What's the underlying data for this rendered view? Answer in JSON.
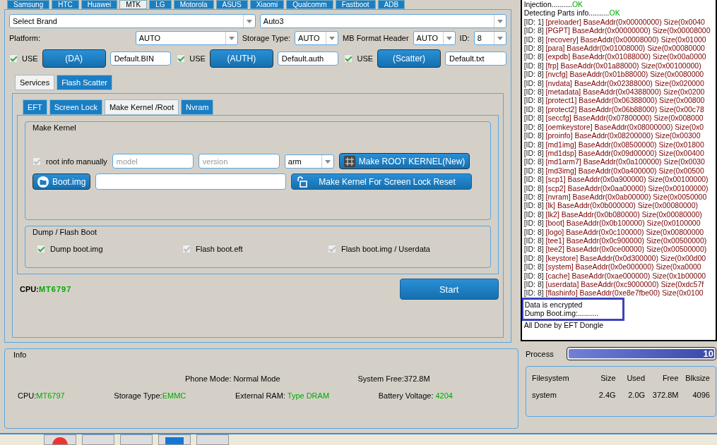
{
  "brand_tabs": [
    {
      "label": "Samsung",
      "selected": false
    },
    {
      "label": "HTC",
      "selected": false
    },
    {
      "label": "Huawei",
      "selected": false
    },
    {
      "label": "MTK",
      "selected": true
    },
    {
      "label": "LG",
      "selected": false
    },
    {
      "label": "Motorola",
      "selected": false
    },
    {
      "label": "ASUS",
      "selected": false
    },
    {
      "label": "Xiaomi",
      "selected": false
    },
    {
      "label": "Qualcomm",
      "selected": false
    },
    {
      "label": "Fastboot",
      "selected": false
    },
    {
      "label": "ADB",
      "selected": false
    }
  ],
  "brand_select": {
    "value": "Select Brand"
  },
  "mode_select": {
    "value": "Auto3"
  },
  "platform": {
    "label": "Platform:",
    "value": "AUTO"
  },
  "storage_type": {
    "label": "Storage Type:",
    "value": "AUTO"
  },
  "mb_format_header": {
    "label": "MB Format Header",
    "value": "AUTO"
  },
  "id": {
    "label": "ID:",
    "value": "8"
  },
  "file_rows": [
    {
      "use_label": "USE",
      "checked": true,
      "button": "(DA)",
      "file": "Default.BIN"
    },
    {
      "use_label": "USE",
      "checked": true,
      "button": "(AUTH)",
      "file": "Default.auth"
    },
    {
      "use_label": "USE",
      "checked": true,
      "button": "(Scatter)",
      "file": "Default.txt"
    }
  ],
  "section_tabs": [
    {
      "label": "Services",
      "selected": true
    },
    {
      "label": "Flash Scatter",
      "selected": false
    }
  ],
  "service_tabs": [
    {
      "label": "EFT",
      "selected": false
    },
    {
      "label": "Screen Lock",
      "selected": false
    },
    {
      "label": "Make Kernel  /Root",
      "selected": true
    },
    {
      "label": "Nvram",
      "selected": false
    }
  ],
  "make_kernel": {
    "title": "Make Kernel",
    "root_info": {
      "label": "root info manually",
      "checked": true,
      "disabled": true
    },
    "model_placeholder": "model",
    "version_placeholder": "version",
    "arch": "arm",
    "make_root_button": "Make  ROOT KERNEL(New)",
    "boot_button": "Boot.img",
    "screen_lock_button": "Make Kernel For Screen Lock Reset"
  },
  "dump_flash": {
    "title": "Dump / Flash Boot",
    "options": [
      {
        "label": "Dump boot.img",
        "checked": true,
        "disabled": false
      },
      {
        "label": "Flash boot.eft",
        "checked": true,
        "disabled": true
      },
      {
        "label": "Flash boot.img / Userdata",
        "checked": true,
        "disabled": true
      }
    ]
  },
  "cpu": {
    "label": "CPU:",
    "value": "MT6797"
  },
  "start_button": "Start",
  "info": {
    "title": "Info",
    "phone_mode": "Phone Mode: Normal Mode",
    "system_free": "System Free:372.8M",
    "cpu_label": "CPU:",
    "cpu_value": "MT6797",
    "storage_label": "Storage Type:",
    "storage_value": "EMMC",
    "ram_label": "External RAM: ",
    "ram_value": "Type DRAM",
    "battery_label": "Battery Voltage: ",
    "battery_value": "4204"
  },
  "log": {
    "lines": [
      {
        "kind": "status",
        "text": "Injection..........",
        "status": "OK"
      },
      {
        "kind": "status",
        "text": "Detecting Parts info..........",
        "status": "OK"
      },
      {
        "kind": "part",
        "id": "[ID: 1]",
        "text": "[preloader] BaseAddr(0x00000000) Size(0x0040"
      },
      {
        "kind": "part",
        "id": "[ID: 8]",
        "text": "[PGPT] BaseAddr(0x00000000) Size(0x00008000"
      },
      {
        "kind": "part",
        "id": "[ID: 8]",
        "text": "[recovery] BaseAddr(0x00008000) Size(0x01000"
      },
      {
        "kind": "part",
        "id": "[ID: 8]",
        "text": "[para] BaseAddr(0x01008000) Size(0x00080000"
      },
      {
        "kind": "part",
        "id": "[ID: 8]",
        "text": "[expdb] BaseAddr(0x01088000) Size(0x00a0000"
      },
      {
        "kind": "part",
        "id": "[ID: 8]",
        "text": "[frp] BaseAddr(0x01a88000) Size(0x00100000)"
      },
      {
        "kind": "part",
        "id": "[ID: 8]",
        "text": "[nvcfg] BaseAddr(0x01b88000) Size(0x0080000"
      },
      {
        "kind": "part",
        "id": "[ID: 8]",
        "text": "[nvdata] BaseAddr(0x02388000) Size(0x020000"
      },
      {
        "kind": "part",
        "id": "[ID: 8]",
        "text": "[metadata] BaseAddr(0x04388000) Size(0x0200"
      },
      {
        "kind": "part",
        "id": "[ID: 8]",
        "text": "[protect1] BaseAddr(0x06388000) Size(0x00800"
      },
      {
        "kind": "part",
        "id": "[ID: 8]",
        "text": "[protect2] BaseAddr(0x06b88000) Size(0x00c78"
      },
      {
        "kind": "part",
        "id": "[ID: 8]",
        "text": "[seccfg] BaseAddr(0x07800000) Size(0x008000"
      },
      {
        "kind": "part",
        "id": "[ID: 8]",
        "text": "[oemkeystore] BaseAddr(0x08000000) Size(0x0"
      },
      {
        "kind": "part",
        "id": "[ID: 8]",
        "text": "[proinfo] BaseAddr(0x08200000) Size(0x00300"
      },
      {
        "kind": "part",
        "id": "[ID: 8]",
        "text": "[md1img] BaseAddr(0x08500000) Size(0x01800"
      },
      {
        "kind": "part",
        "id": "[ID: 8]",
        "text": "[md1dsp] BaseAddr(0x09d00000) Size(0x00400"
      },
      {
        "kind": "part",
        "id": "[ID: 8]",
        "text": "[md1arm7] BaseAddr(0x0a100000) Size(0x0030"
      },
      {
        "kind": "part",
        "id": "[ID: 8]",
        "text": "[md3img] BaseAddr(0x0a400000) Size(0x00500"
      },
      {
        "kind": "part",
        "id": "[ID: 8]",
        "text": "[scp1] BaseAddr(0x0a900000) Size(0x00100000)"
      },
      {
        "kind": "part",
        "id": "[ID: 8]",
        "text": "[scp2] BaseAddr(0x0aa00000) Size(0x00100000)"
      },
      {
        "kind": "part",
        "id": "[ID: 8]",
        "text": "[nvram] BaseAddr(0x0ab00000) Size(0x0050000"
      },
      {
        "kind": "part",
        "id": "[ID: 8]",
        "text": "[lk] BaseAddr(0x0b000000) Size(0x00080000)"
      },
      {
        "kind": "part",
        "id": "[ID: 8]",
        "text": "[lk2] BaseAddr(0x0b080000) Size(0x00080000)"
      },
      {
        "kind": "part",
        "id": "[ID: 8]",
        "text": "[boot] BaseAddr(0x0b100000) Size(0x0100000"
      },
      {
        "kind": "part",
        "id": "[ID: 8]",
        "text": "[logo] BaseAddr(0x0c100000) Size(0x00800000"
      },
      {
        "kind": "part",
        "id": "[ID: 8]",
        "text": "[tee1] BaseAddr(0x0c900000) Size(0x00500000)"
      },
      {
        "kind": "part",
        "id": "[ID: 8]",
        "text": "[tee2] BaseAddr(0x0ce00000) Size(0x00500000)"
      },
      {
        "kind": "part",
        "id": "[ID: 8]",
        "text": "[keystore] BaseAddr(0x0d300000) Size(0x00d00"
      },
      {
        "kind": "part",
        "id": "[ID: 8]",
        "text": "[system] BaseAddr(0x0e000000) Size(0xa0000"
      },
      {
        "kind": "part",
        "id": "[ID: 8]",
        "text": "[cache] BaseAddr(0xae000000) Size(0x1b00000"
      },
      {
        "kind": "part",
        "id": "[ID: 8]",
        "text": "[userdata] BaseAddr(0xc9000000) Size(0xdc57f"
      },
      {
        "kind": "part",
        "id": "[ID: 8]",
        "text": "[flashinfo] BaseAddr(0xe8e7fbe00) Size(0x0100"
      }
    ],
    "highlight_lines": [
      "Data is encrypted",
      "Dump Boot.img:.........."
    ],
    "footer_line": "All Done by EFT Dongle"
  },
  "process": {
    "label": "Process",
    "level": 1,
    "reading": "10"
  },
  "filesystem": {
    "columns": [
      "Filesystem",
      "Size",
      "Used",
      "Free",
      "Blksize"
    ],
    "rows": [
      [
        "system",
        "2.4G",
        "2.0G",
        "372.8M",
        "4096"
      ]
    ]
  }
}
